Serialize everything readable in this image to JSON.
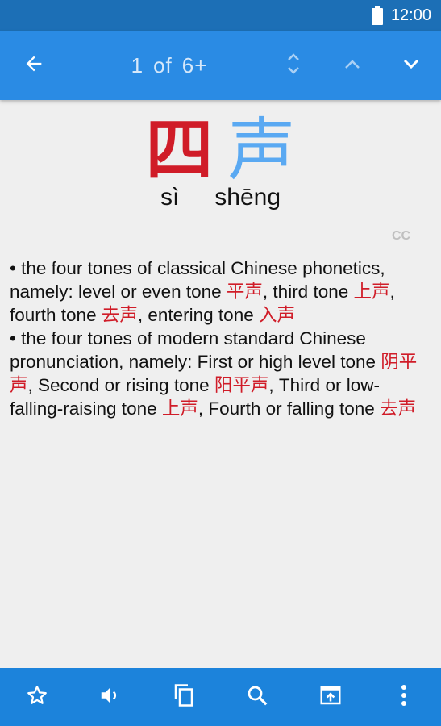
{
  "status_bar": {
    "time": "12:00"
  },
  "app_bar": {
    "counter_current": "1",
    "counter_of": "of",
    "counter_total": "6+"
  },
  "entry": {
    "char1": "四",
    "char2": "声",
    "pinyin1": "sì",
    "pinyin2": "shēng",
    "source_label": "CC"
  },
  "definition": {
    "line1": {
      "t1": "• the four tones of classical Chinese phonetics, namely: level or even tone ",
      "r1": "平声",
      "t2": ", third tone ",
      "r2": "上声",
      "t3": ", fourth tone ",
      "r3": "去声",
      "t4": ", entering tone ",
      "r4": "入声"
    },
    "line2": {
      "t1": "• the four tones of modern standard Chinese pronunciation, namely: First or high level tone ",
      "r1": "阴平声",
      "t2": ", Second or rising tone ",
      "r2": "阳平声",
      "t3": ", Third or low-falling-raising tone ",
      "r3": "上声",
      "t4": ", Fourth or falling tone ",
      "r4": "去声"
    }
  },
  "colors": {
    "status_bar": "#1c6fb6",
    "app_bar": "#2a8be4",
    "bottom_bar": "#1c83db",
    "char1": "#d01c28",
    "char2": "#5aa9f2",
    "highlight": "#d01c28"
  },
  "icons": {
    "battery": "battery-icon",
    "back": "arrow-left-icon",
    "expand": "unfold-icon",
    "up": "chevron-up-icon",
    "down": "chevron-down-icon",
    "favorite": "star-outline-icon",
    "speak": "volume-icon",
    "copy": "copy-icon",
    "search": "search-icon",
    "share": "open-in-icon",
    "more": "more-vertical-icon"
  }
}
